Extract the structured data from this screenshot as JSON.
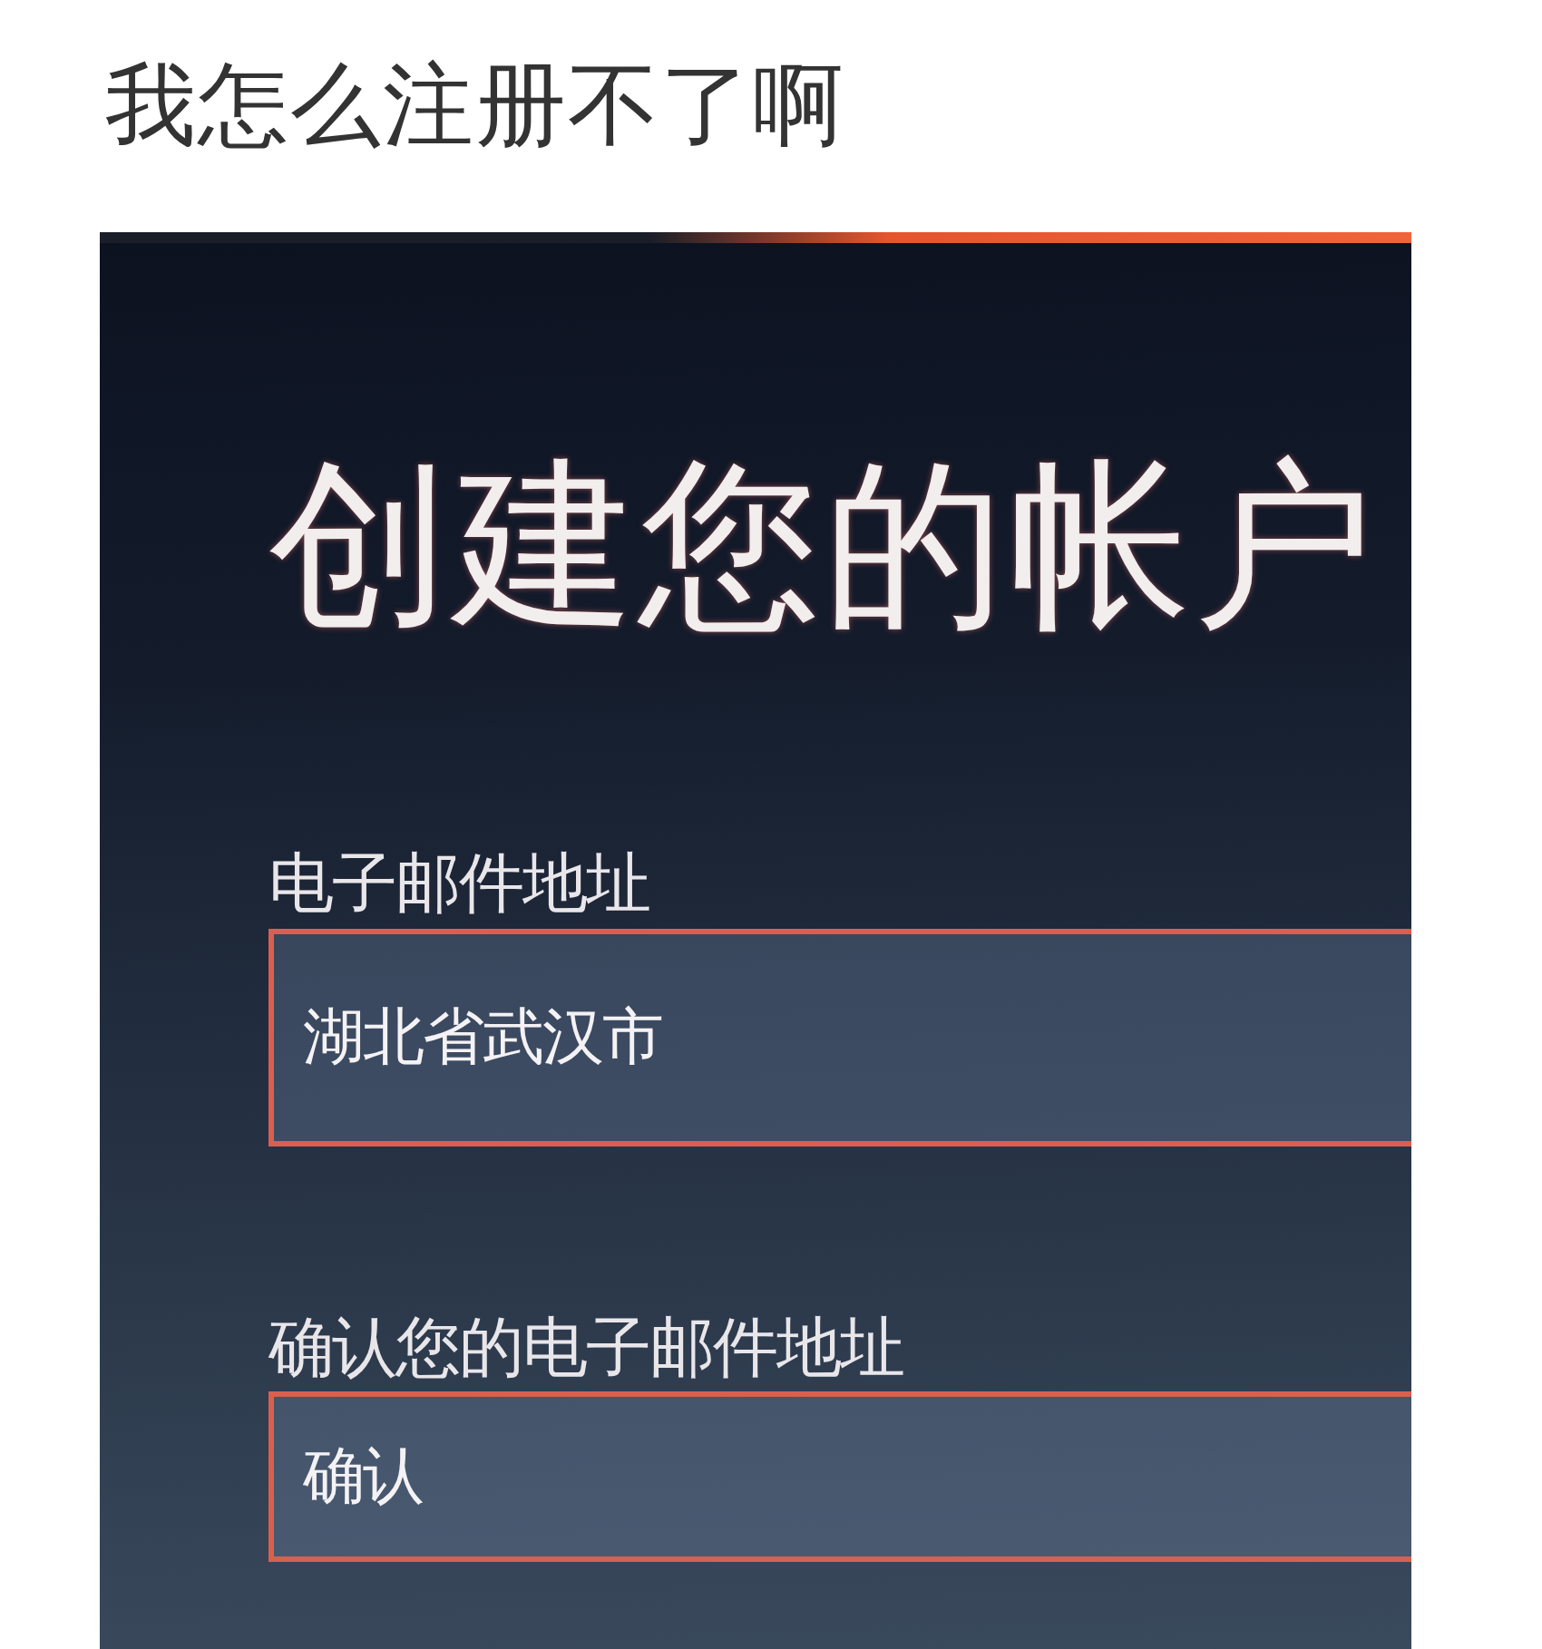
{
  "post": {
    "caption": "我怎么注册不了啊"
  },
  "form": {
    "title": "创建您的帐户",
    "fields": [
      {
        "label": "电子邮件地址",
        "value": "湖北省武汉市"
      },
      {
        "label": "确认您的电子邮件地址",
        "value": "确认"
      }
    ]
  }
}
